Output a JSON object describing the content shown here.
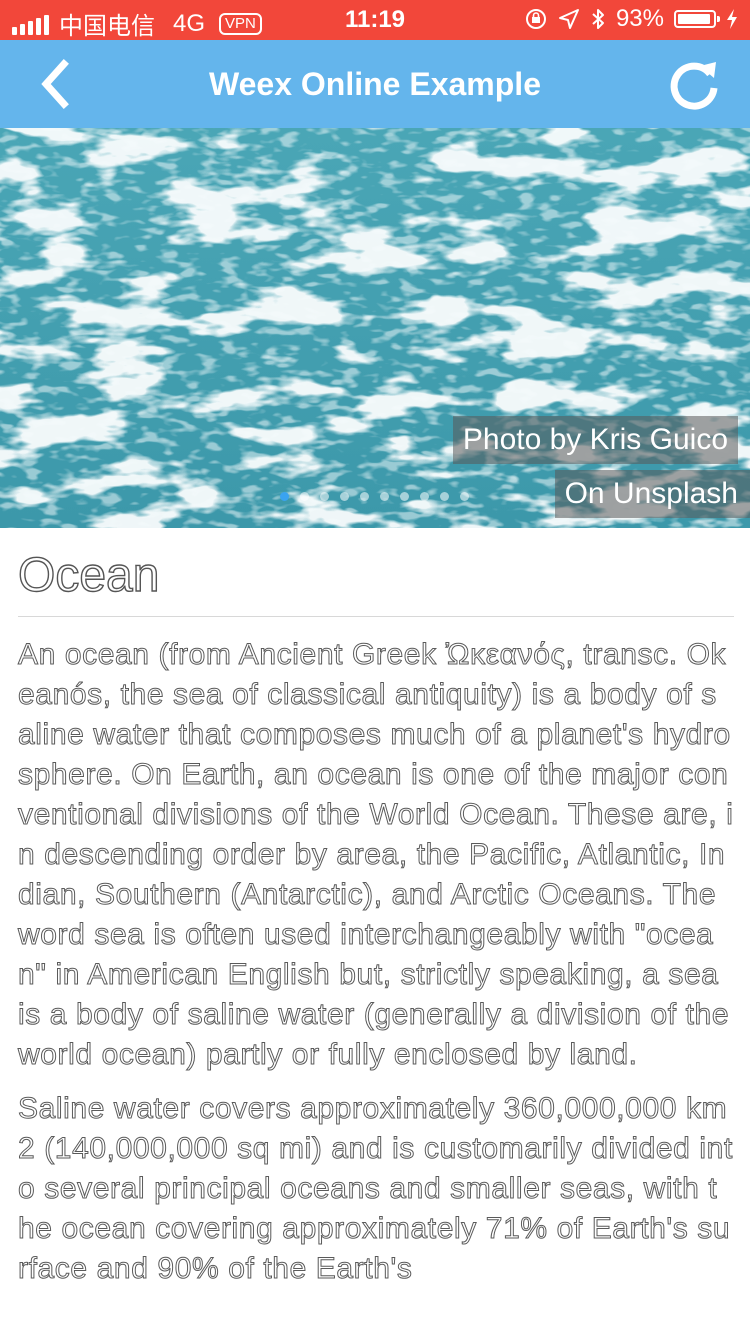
{
  "status_bar": {
    "carrier": "中国电信",
    "network": "4G",
    "vpn": "VPN",
    "time": "11:19",
    "battery_percent": "93%",
    "battery_level": 0.93
  },
  "nav": {
    "title": "Weex Online Example"
  },
  "hero": {
    "caption_line1": "Photo by Kris Guico",
    "caption_line2": "On Unsplash",
    "slide_count": 10,
    "active_slide": 1
  },
  "article": {
    "heading": "Ocean",
    "paragraph1": "An ocean (from Ancient Greek Ὠκεανός, transc. Okeanós, the sea of classical antiquity) is a body of saline water that composes much of a planet's hydrosphere. On Earth, an ocean is one of the major conventional divisions of the World Ocean. These are, in descending order by area, the Pacific, Atlantic, Indian, Southern (Antarctic), and Arctic Oceans. The word sea is often used interchangeably with \"ocean\" in American English but, strictly speaking, a sea is a body of saline water (generally a division of the world ocean) partly or fully enclosed by land.",
    "paragraph2": "Saline water covers approximately 360,000,000 km2 (140,000,000 sq mi) and is customarily divided into several principal oceans and smaller seas, with the ocean covering approximately 71% of Earth's surface and 90% of the Earth's"
  }
}
